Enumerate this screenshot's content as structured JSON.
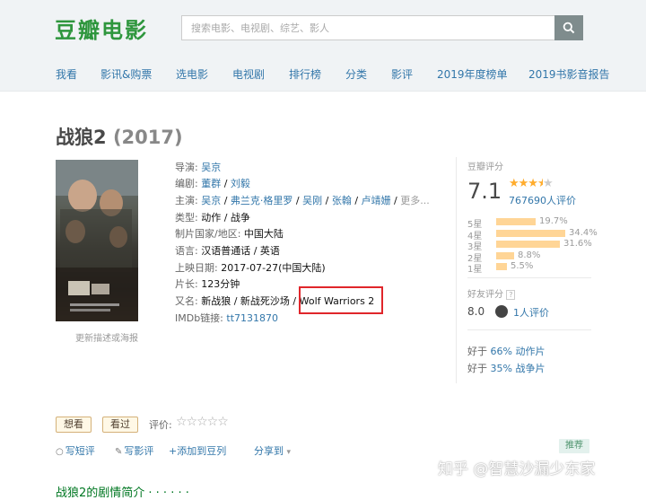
{
  "header": {
    "logo": "豆瓣电影",
    "search_placeholder": "搜索电影、电视剧、综艺、影人"
  },
  "nav": [
    "我看",
    "影讯&购票",
    "选电影",
    "电视剧",
    "排行榜",
    "分类",
    "影评",
    "2019年度榜单",
    "2019书影音报告"
  ],
  "movie": {
    "title": "战狼2",
    "year": "(2017)",
    "poster_caption": "更新描述或海报"
  },
  "info": {
    "director_label": "导演:",
    "director": "吴京",
    "writer_label": "编剧:",
    "writers": [
      "董群",
      "刘毅"
    ],
    "cast_label": "主演:",
    "cast": [
      "吴京",
      "弗兰克·格里罗",
      "吴刚",
      "张翰",
      "卢靖姗"
    ],
    "cast_more": "更多...",
    "genre_label": "类型:",
    "genre": "动作 / 战争",
    "region_label": "制片国家/地区:",
    "region": "中国大陆",
    "language_label": "语言:",
    "language": "汉语普通话 / 英语",
    "release_label": "上映日期:",
    "release": "2017-07-27(中国大陆)",
    "runtime_label": "片长:",
    "runtime": "123分钟",
    "aka_label": "又名:",
    "aka": "新战狼 / 新战死沙场 / Wolf Warriors 2",
    "imdb_label": "IMDb链接:",
    "imdb": "tt7131870"
  },
  "rating": {
    "label": "豆瓣评分",
    "score": "7.1",
    "stars": 3.5,
    "votes": "767690人评价",
    "distribution": [
      {
        "label": "5星",
        "pct": "19.7%",
        "value": 19.7
      },
      {
        "label": "4星",
        "pct": "34.4%",
        "value": 34.4
      },
      {
        "label": "3星",
        "pct": "31.6%",
        "value": 31.6
      },
      {
        "label": "2星",
        "pct": "8.8%",
        "value": 8.8
      },
      {
        "label": "1星",
        "pct": "5.5%",
        "value": 5.5
      }
    ],
    "friend_label": "好友评分",
    "friend_score": "8.0",
    "friend_votes": "1人评价",
    "better1_prefix": "好于",
    "better1_pct": "66%",
    "better1_genre": "动作片",
    "better2_prefix": "好于",
    "better2_pct": "35%",
    "better2_genre": "战争片"
  },
  "actions": {
    "want": "想看",
    "seen": "看过",
    "rate_label": "评价:",
    "short_review": "写短评",
    "review": "写影评",
    "add_doulist": "+添加到豆列",
    "share": "分享到"
  },
  "recommend": "推荐",
  "watermark": "知乎 @智慧沙漏少东家",
  "summary_heading": "战狼2的剧情简介 · · · · · ·",
  "colors": {
    "brand": "#2e963d",
    "link": "#3377aa",
    "highlight_box": "#e0262b",
    "star": "#ffac2d",
    "bar": "#ffd596"
  }
}
